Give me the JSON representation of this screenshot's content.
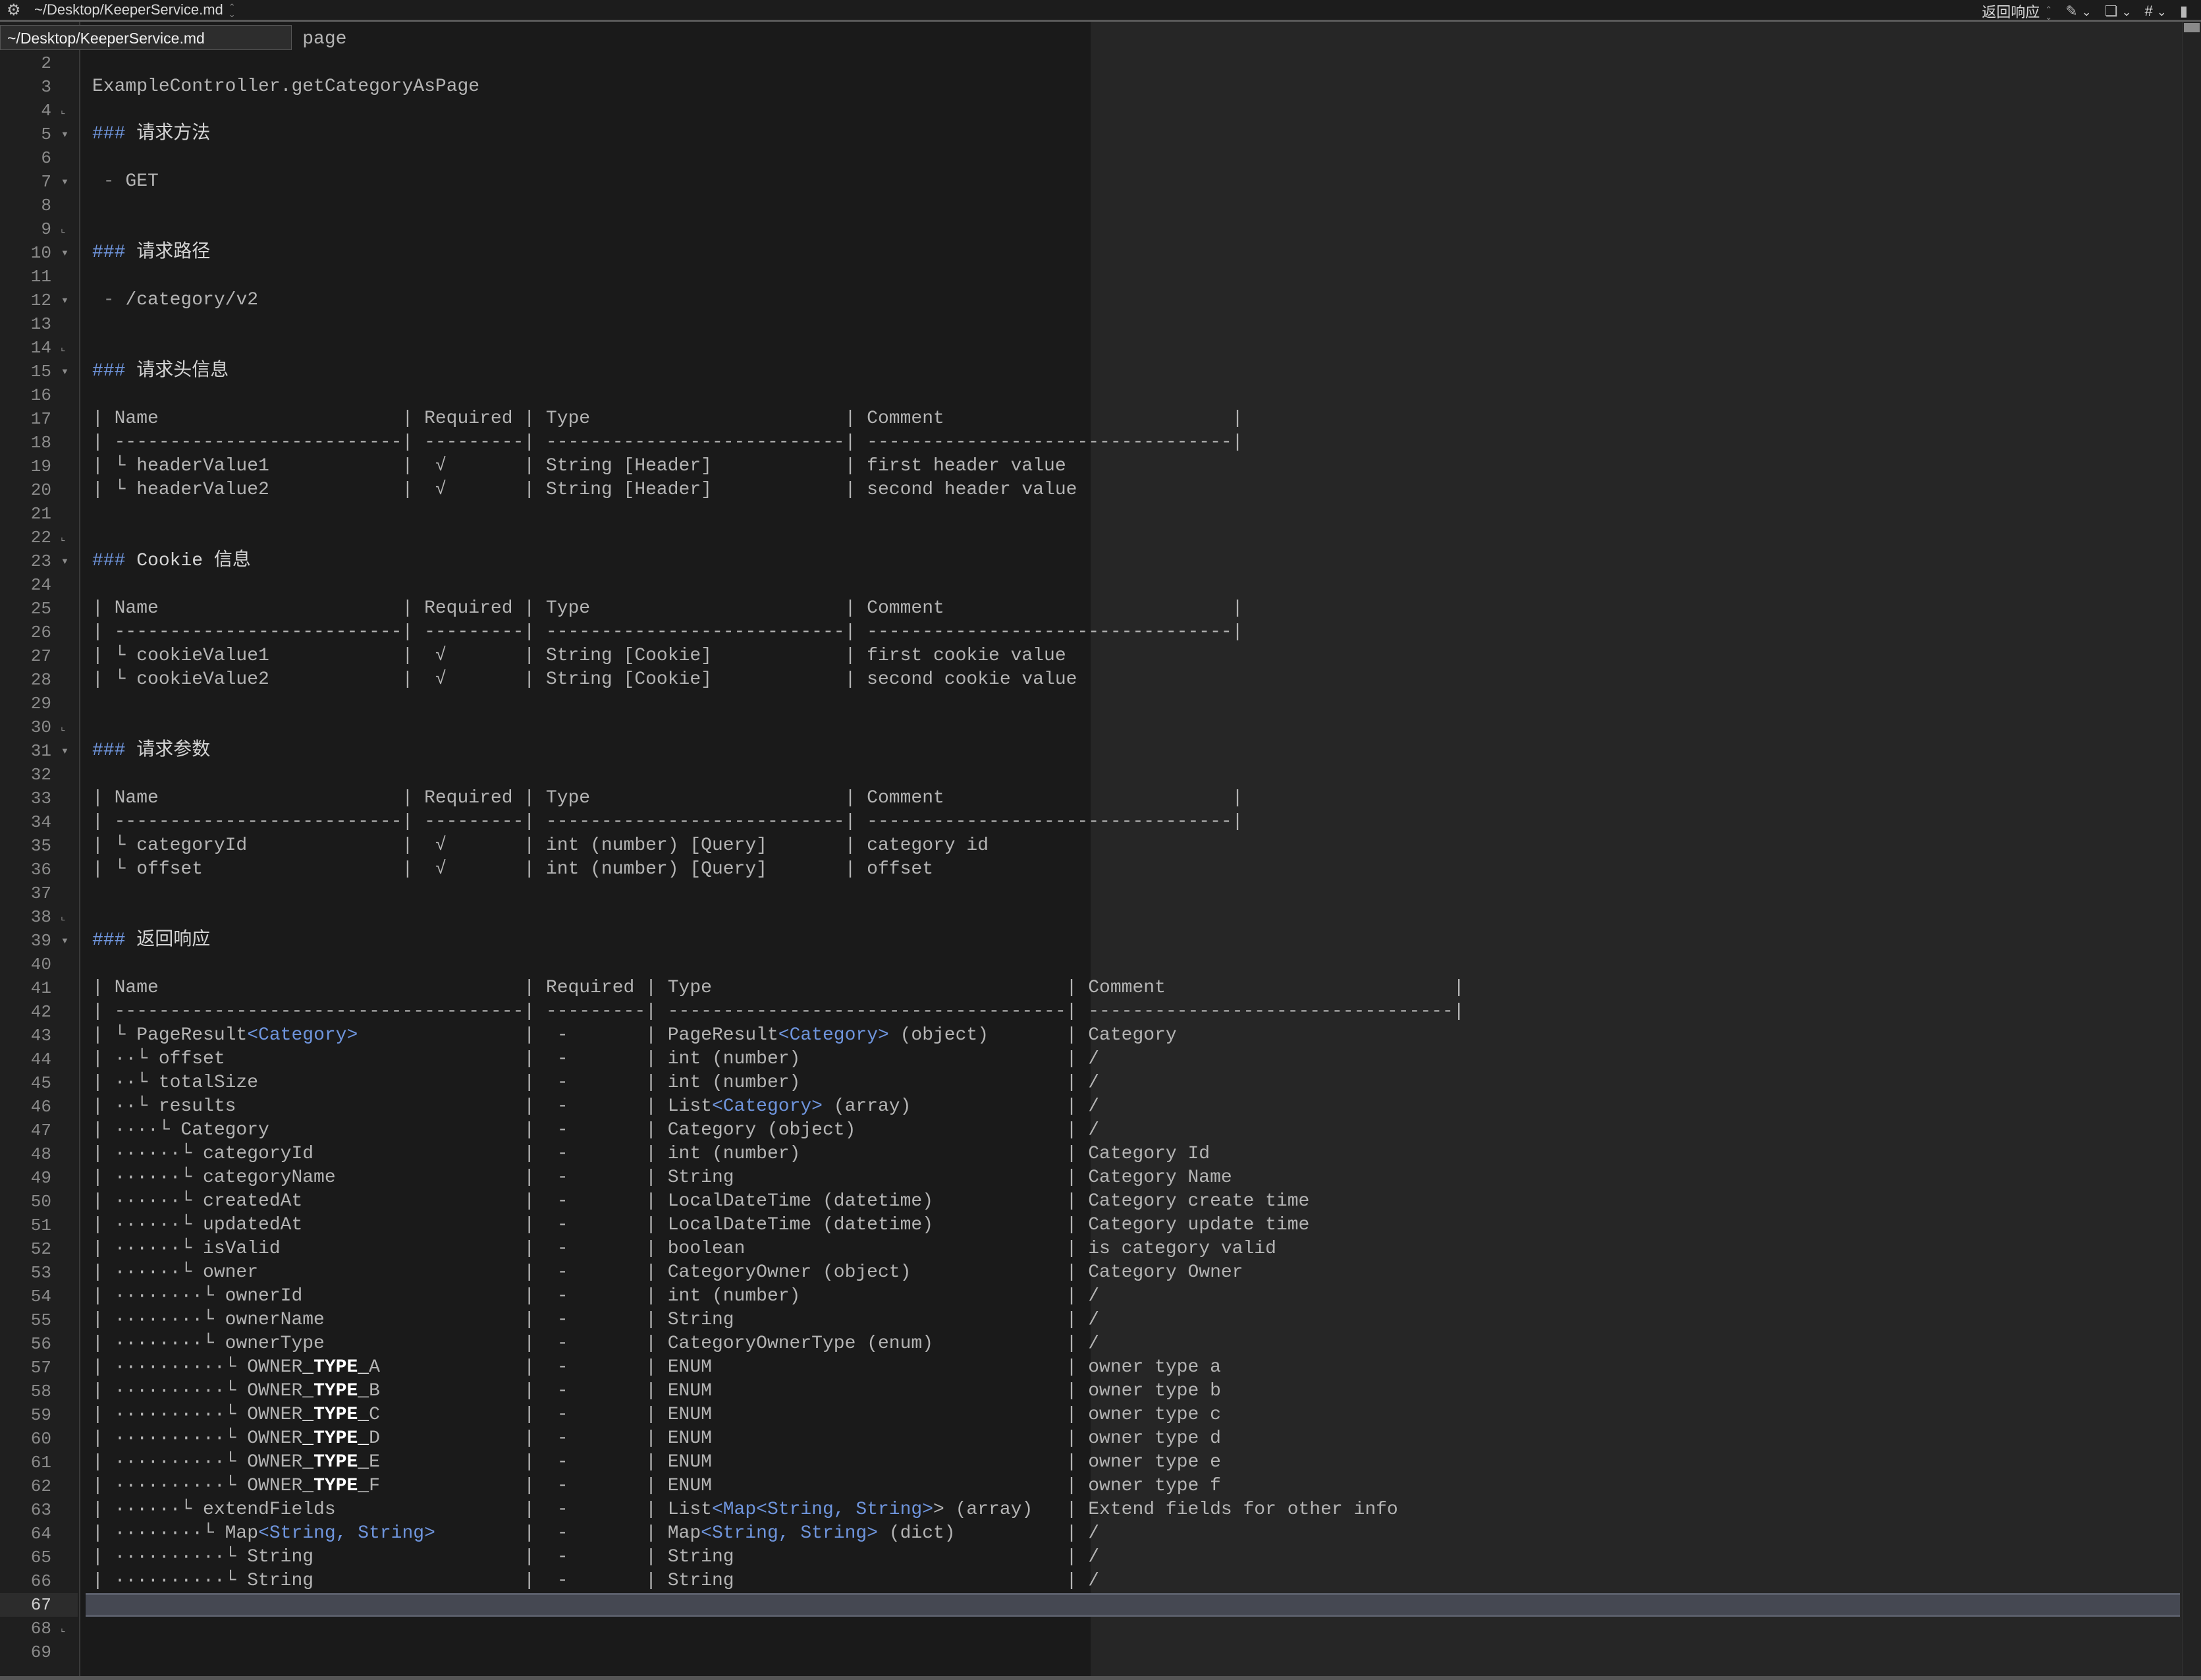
{
  "window": {
    "path": "~/Desktop/KeeperService.md",
    "tooltip": "~/Desktop/KeeperService.md",
    "section_selector": "返回响应",
    "hash_label": "#"
  },
  "icons": [
    "gear-icon",
    "updown-icon",
    "pin-icon",
    "chevron-down-icon",
    "square-icon",
    "hash-icon",
    "document-icon"
  ],
  "colors": {
    "accent_blue": "#6f95dd",
    "text": "#b4b4b4",
    "current_line": "#454852"
  },
  "current_line": 67,
  "lines": [
    {
      "n": "1",
      "cells": [
        [
          "           gory as page"
        ]
      ]
    },
    {
      "n": "2",
      "cells": []
    },
    {
      "n": "3",
      "cells": [
        [
          "ExampleController.getCategoryAsPage"
        ]
      ]
    },
    {
      "n": "4",
      "fold": "end",
      "cells": []
    },
    {
      "n": "5",
      "fold": "open",
      "cells": [
        [
          {
            "t": "### ",
            "k": "h"
          },
          {
            "t": "请求方法",
            "k": "x"
          }
        ]
      ]
    },
    {
      "n": "6",
      "cells": []
    },
    {
      "n": "7",
      "fold": "open",
      "cells": [
        [
          {
            "t": " - ",
            "k": "g"
          },
          "GET"
        ]
      ]
    },
    {
      "n": "8",
      "cells": []
    },
    {
      "n": "9",
      "fold": "end",
      "cells": []
    },
    {
      "n": "10",
      "fold": "open",
      "cells": [
        [
          {
            "t": "### ",
            "k": "h"
          },
          {
            "t": "请求路径",
            "k": "x"
          }
        ]
      ]
    },
    {
      "n": "11",
      "cells": []
    },
    {
      "n": "12",
      "fold": "open",
      "cells": [
        [
          {
            "t": " - ",
            "k": "g"
          },
          "/category/v2"
        ]
      ]
    },
    {
      "n": "13",
      "cells": []
    },
    {
      "n": "14",
      "fold": "end",
      "cells": []
    },
    {
      "n": "15",
      "fold": "open",
      "cells": [
        [
          {
            "t": "### ",
            "k": "h"
          },
          {
            "t": "请求头信息",
            "k": "x"
          }
        ]
      ]
    },
    {
      "n": "16",
      "cells": []
    },
    {
      "n": "17",
      "tbl": "a",
      "cells": [
        [
          "| Name"
        ],
        [
          "| Required"
        ],
        [
          "| Type"
        ],
        [
          "| Comment"
        ],
        [
          "|"
        ]
      ]
    },
    {
      "n": "18",
      "tbl": "a",
      "cells": [
        [
          "| --------------------------"
        ],
        [
          "| ---------"
        ],
        [
          "| ---------------------------"
        ],
        [
          "| ---------------------------------"
        ],
        [
          "|"
        ]
      ]
    },
    {
      "n": "19",
      "tbl": "a",
      "cells": [
        [
          "| └ headerValue1"
        ],
        [
          "|  √"
        ],
        [
          "| String [Header]"
        ],
        [
          "| first header value"
        ]
      ]
    },
    {
      "n": "20",
      "tbl": "a",
      "cells": [
        [
          "| └ headerValue2"
        ],
        [
          "|  √"
        ],
        [
          "| String [Header]"
        ],
        [
          "| second header value"
        ]
      ]
    },
    {
      "n": "21",
      "cells": []
    },
    {
      "n": "22",
      "fold": "end",
      "cells": []
    },
    {
      "n": "23",
      "fold": "open",
      "cells": [
        [
          {
            "t": "### ",
            "k": "h"
          },
          {
            "t": "Cookie 信息",
            "k": "x"
          }
        ]
      ]
    },
    {
      "n": "24",
      "cells": []
    },
    {
      "n": "25",
      "tbl": "a",
      "cells": [
        [
          "| Name"
        ],
        [
          "| Required"
        ],
        [
          "| Type"
        ],
        [
          "| Comment"
        ],
        [
          "|"
        ]
      ]
    },
    {
      "n": "26",
      "tbl": "a",
      "cells": [
        [
          "| --------------------------"
        ],
        [
          "| ---------"
        ],
        [
          "| ---------------------------"
        ],
        [
          "| ---------------------------------"
        ],
        [
          "|"
        ]
      ]
    },
    {
      "n": "27",
      "tbl": "a",
      "cells": [
        [
          "| └ cookieValue1"
        ],
        [
          "|  √"
        ],
        [
          "| String [Cookie]"
        ],
        [
          "| first cookie value"
        ]
      ]
    },
    {
      "n": "28",
      "tbl": "a",
      "cells": [
        [
          "| └ cookieValue2"
        ],
        [
          "|  √"
        ],
        [
          "| String [Cookie]"
        ],
        [
          "| second cookie value"
        ]
      ]
    },
    {
      "n": "29",
      "cells": []
    },
    {
      "n": "30",
      "fold": "end",
      "cells": []
    },
    {
      "n": "31",
      "fold": "open",
      "cells": [
        [
          {
            "t": "### ",
            "k": "h"
          },
          {
            "t": "请求参数",
            "k": "x"
          }
        ]
      ]
    },
    {
      "n": "32",
      "cells": []
    },
    {
      "n": "33",
      "tbl": "a",
      "cells": [
        [
          "| Name"
        ],
        [
          "| Required"
        ],
        [
          "| Type"
        ],
        [
          "| Comment"
        ],
        [
          "|"
        ]
      ]
    },
    {
      "n": "34",
      "tbl": "a",
      "cells": [
        [
          "| --------------------------"
        ],
        [
          "| ---------"
        ],
        [
          "| ---------------------------"
        ],
        [
          "| ---------------------------------"
        ],
        [
          "|"
        ]
      ]
    },
    {
      "n": "35",
      "tbl": "a",
      "cells": [
        [
          "| └ categoryId"
        ],
        [
          "|  √"
        ],
        [
          "| int (number) [Query]"
        ],
        [
          "| category id"
        ]
      ]
    },
    {
      "n": "36",
      "tbl": "a",
      "cells": [
        [
          "| └ offset"
        ],
        [
          "|  √"
        ],
        [
          "| int (number) [Query]"
        ],
        [
          "| offset"
        ]
      ]
    },
    {
      "n": "37",
      "cells": []
    },
    {
      "n": "38",
      "fold": "end",
      "cells": []
    },
    {
      "n": "39",
      "fold": "open",
      "cells": [
        [
          {
            "t": "### ",
            "k": "h"
          },
          {
            "t": "返回响应",
            "k": "x"
          }
        ]
      ]
    },
    {
      "n": "40",
      "cells": []
    },
    {
      "n": "41",
      "tbl": "b",
      "cells": [
        [
          "| Name"
        ],
        [
          "| Required"
        ],
        [
          "| Type"
        ],
        [
          "| Comment"
        ],
        [
          "|"
        ]
      ]
    },
    {
      "n": "42",
      "tbl": "b",
      "cells": [
        [
          "| -------------------------------------"
        ],
        [
          "| ---------"
        ],
        [
          "| ------------------------------------"
        ],
        [
          "| ---------------------------------"
        ],
        [
          "|"
        ]
      ]
    },
    {
      "n": "43",
      "tbl": "b",
      "cells": [
        [
          "| └ PageResult",
          {
            "t": "<Category>",
            "k": "b"
          }
        ],
        [
          "|  -"
        ],
        [
          "| PageResult",
          {
            "t": "<Category>",
            "k": "b"
          },
          " (object)"
        ],
        [
          "| Category"
        ]
      ]
    },
    {
      "n": "44",
      "tbl": "b",
      "cells": [
        [
          "| ··└ offset"
        ],
        [
          "|  -"
        ],
        [
          "| int (number)"
        ],
        [
          "| /"
        ]
      ]
    },
    {
      "n": "45",
      "tbl": "b",
      "cells": [
        [
          "| ··└ totalSize"
        ],
        [
          "|  -"
        ],
        [
          "| int (number)"
        ],
        [
          "| /"
        ]
      ]
    },
    {
      "n": "46",
      "tbl": "b",
      "cells": [
        [
          "| ··└ results"
        ],
        [
          "|  -"
        ],
        [
          "| List",
          {
            "t": "<Category>",
            "k": "b"
          },
          " (array)"
        ],
        [
          "| /"
        ]
      ]
    },
    {
      "n": "47",
      "tbl": "b",
      "cells": [
        [
          "| ····└ Category"
        ],
        [
          "|  -"
        ],
        [
          "| Category (object)"
        ],
        [
          "| /"
        ]
      ]
    },
    {
      "n": "48",
      "tbl": "b",
      "cells": [
        [
          "| ······└ categoryId"
        ],
        [
          "|  -"
        ],
        [
          "| int (number)"
        ],
        [
          "| Category Id"
        ]
      ]
    },
    {
      "n": "49",
      "tbl": "b",
      "cells": [
        [
          "| ······└ categoryName"
        ],
        [
          "|  -"
        ],
        [
          "| String"
        ],
        [
          "| Category Name"
        ]
      ]
    },
    {
      "n": "50",
      "tbl": "b",
      "cells": [
        [
          "| ······└ createdAt"
        ],
        [
          "|  -"
        ],
        [
          "| LocalDateTime (datetime)"
        ],
        [
          "| Category create time"
        ]
      ]
    },
    {
      "n": "51",
      "tbl": "b",
      "cells": [
        [
          "| ······└ updatedAt"
        ],
        [
          "|  -"
        ],
        [
          "| LocalDateTime (datetime)"
        ],
        [
          "| Category update time"
        ]
      ]
    },
    {
      "n": "52",
      "tbl": "b",
      "cells": [
        [
          "| ······└ isValid"
        ],
        [
          "|  -"
        ],
        [
          "| boolean"
        ],
        [
          "| is category valid"
        ]
      ]
    },
    {
      "n": "53",
      "tbl": "b",
      "cells": [
        [
          "| ······└ owner"
        ],
        [
          "|  -"
        ],
        [
          "| CategoryOwner (object)"
        ],
        [
          "| Category Owner"
        ]
      ]
    },
    {
      "n": "54",
      "tbl": "b",
      "cells": [
        [
          "| ········└ ownerId"
        ],
        [
          "|  -"
        ],
        [
          "| int (number)"
        ],
        [
          "| /"
        ]
      ]
    },
    {
      "n": "55",
      "tbl": "b",
      "cells": [
        [
          "| ········└ ownerName"
        ],
        [
          "|  -"
        ],
        [
          "| String"
        ],
        [
          "| /"
        ]
      ]
    },
    {
      "n": "56",
      "tbl": "b",
      "cells": [
        [
          "| ········└ ownerType"
        ],
        [
          "|  -"
        ],
        [
          "| CategoryOwnerType (enum)"
        ],
        [
          "| /"
        ]
      ]
    },
    {
      "n": "57",
      "tbl": "b",
      "cells": [
        [
          "| ··········└ OWNER",
          {
            "t": "_TYPE_",
            "k": "w"
          },
          "A"
        ],
        [
          "|  -"
        ],
        [
          "| ENUM"
        ],
        [
          "| owner type a"
        ]
      ]
    },
    {
      "n": "58",
      "tbl": "b",
      "cells": [
        [
          "| ··········└ OWNER",
          {
            "t": "_TYPE_",
            "k": "w"
          },
          "B"
        ],
        [
          "|  -"
        ],
        [
          "| ENUM"
        ],
        [
          "| owner type b"
        ]
      ]
    },
    {
      "n": "59",
      "tbl": "b",
      "cells": [
        [
          "| ··········└ OWNER",
          {
            "t": "_TYPE_",
            "k": "w"
          },
          "C"
        ],
        [
          "|  -"
        ],
        [
          "| ENUM"
        ],
        [
          "| owner type c"
        ]
      ]
    },
    {
      "n": "60",
      "tbl": "b",
      "cells": [
        [
          "| ··········└ OWNER",
          {
            "t": "_TYPE_",
            "k": "w"
          },
          "D"
        ],
        [
          "|  -"
        ],
        [
          "| ENUM"
        ],
        [
          "| owner type d"
        ]
      ]
    },
    {
      "n": "61",
      "tbl": "b",
      "cells": [
        [
          "| ··········└ OWNER",
          {
            "t": "_TYPE_",
            "k": "w"
          },
          "E"
        ],
        [
          "|  -"
        ],
        [
          "| ENUM"
        ],
        [
          "| owner type e"
        ]
      ]
    },
    {
      "n": "62",
      "tbl": "b",
      "cells": [
        [
          "| ··········└ OWNER",
          {
            "t": "_TYPE_",
            "k": "w"
          },
          "F"
        ],
        [
          "|  -"
        ],
        [
          "| ENUM"
        ],
        [
          "| owner type f"
        ]
      ]
    },
    {
      "n": "63",
      "tbl": "b",
      "cells": [
        [
          "| ······└ extendFields"
        ],
        [
          "|  -"
        ],
        [
          "| List",
          {
            "t": "<Map<String, String>",
            "k": "b"
          },
          "> (array)"
        ],
        [
          "| Extend fields for other info"
        ]
      ]
    },
    {
      "n": "64",
      "tbl": "b",
      "cells": [
        [
          "| ········└ Map",
          {
            "t": "<String, String>",
            "k": "b"
          }
        ],
        [
          "|  -"
        ],
        [
          "| Map",
          {
            "t": "<String, String>",
            "k": "b"
          },
          " (dict)"
        ],
        [
          "| /"
        ]
      ]
    },
    {
      "n": "65",
      "tbl": "b",
      "cells": [
        [
          "| ··········└ String"
        ],
        [
          "|  -"
        ],
        [
          "| String"
        ],
        [
          "| /"
        ]
      ]
    },
    {
      "n": "66",
      "tbl": "b",
      "cells": [
        [
          "| ··········└ String"
        ],
        [
          "|  -"
        ],
        [
          "| String"
        ],
        [
          "| /"
        ]
      ]
    },
    {
      "n": "67",
      "cells": []
    },
    {
      "n": "68",
      "fold": "end",
      "cells": []
    },
    {
      "n": "69",
      "cells": []
    }
  ]
}
